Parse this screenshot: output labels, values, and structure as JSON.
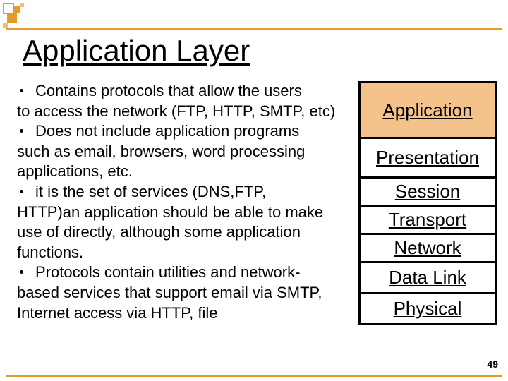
{
  "title": "Application Layer",
  "bullets": [
    {
      "lead": "Contains protocols that  allow the users",
      "rest": "to access the network (FTP, HTTP, SMTP, etc)"
    },
    {
      "lead": "Does not include application programs",
      "rest": "such as email, browsers, word processing applications, etc."
    },
    {
      "lead": "it is the set of services (DNS,FTP,",
      "rest": "HTTP)an application should be able to make use of directly, although some application functions."
    },
    {
      "lead": "Protocols contain utilities and network-",
      "rest": "based services that support email via SMTP, Internet access via HTTP, file"
    }
  ],
  "layers": [
    "Application",
    "Presentation",
    "Session",
    "Transport",
    "Network",
    "Data Link",
    "Physical"
  ],
  "page_number": "49",
  "colors": {
    "accent": "#e79a2c",
    "app_fill": "#f5c28c"
  }
}
